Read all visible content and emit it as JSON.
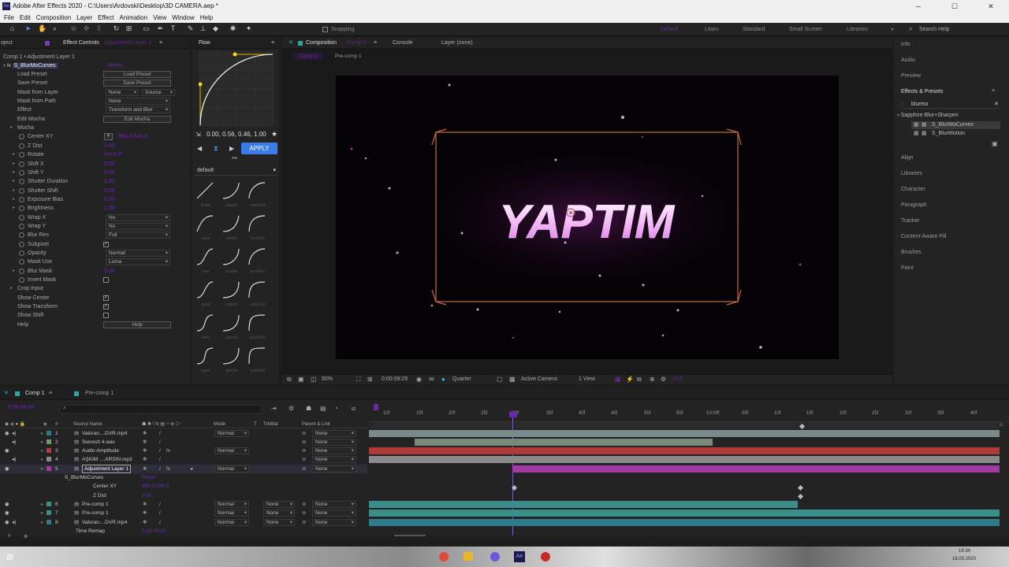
{
  "window": {
    "title": "Adobe After Effects 2020 - C:\\Users\\Ardovski\\Desktop\\3D CAMERA.aep *",
    "minimize": "─",
    "maximize": "☐",
    "close": "✕"
  },
  "menu": [
    "File",
    "Edit",
    "Composition",
    "Layer",
    "Effect",
    "Animation",
    "View",
    "Window",
    "Help"
  ],
  "toolbar": {
    "snapping": "Snapping",
    "workspaces": [
      "Default",
      "Learn",
      "Standard",
      "Small Screen",
      "Libraries"
    ],
    "more": "»",
    "search_placeholder": "Search Help"
  },
  "effect_controls": {
    "tab_left": "oject",
    "tab": "Effect Controls",
    "tab_suffix": "Adjustment Layer 1",
    "breadcrumb": "Comp 1 • Adjustment Layer 1",
    "effect_name": "S_BlurMoCurves",
    "effect_reset": "Reset",
    "rows": [
      {
        "label": "Load Preset",
        "button": "Load Preset"
      },
      {
        "label": "Save Preset",
        "button": "Save Preset"
      },
      {
        "label": "Mask from Layer",
        "dd1": "None",
        "dd2": "Source"
      },
      {
        "label": "Mask from Path",
        "dd1": "None"
      },
      {
        "label": "Effect",
        "dd1": "Transform and Blur"
      },
      {
        "label": "Edit Mocha",
        "button": "Edit Mocha"
      },
      {
        "label": "Mocha"
      },
      {
        "label": "Center XY",
        "value": "960.0,540.0"
      },
      {
        "label": "Z Dist",
        "value": "0.00"
      },
      {
        "label": "Rotate",
        "value": "0x+0.0°"
      },
      {
        "label": "Shift X",
        "value": "0.00"
      },
      {
        "label": "Shift Y",
        "value": "0.00"
      },
      {
        "label": "Shutter Duration",
        "value": "1.00"
      },
      {
        "label": "Shutter Shift",
        "value": "0.00"
      },
      {
        "label": "Exposure Bias",
        "value": "0.00"
      },
      {
        "label": "Brightness",
        "value": "1.00"
      },
      {
        "label": "Wrap X",
        "dd1": "No"
      },
      {
        "label": "Wrap Y",
        "dd1": "No"
      },
      {
        "label": "Blur Res",
        "dd1": "Full"
      },
      {
        "label": "Subpixel",
        "checked": true
      },
      {
        "label": "Opacity",
        "dd1": "Normal"
      },
      {
        "label": "Mask Use",
        "dd1": "Luma"
      },
      {
        "label": "Blur Mask",
        "value": "0.00"
      },
      {
        "label": "Invert Mask",
        "checked": false
      },
      {
        "label": "Crop Input"
      },
      {
        "label": "Show Center",
        "checked": true
      },
      {
        "label": "Show Transform",
        "checked": true
      },
      {
        "label": "Show Shift",
        "checked": false
      },
      {
        "label": "Help",
        "button": "Help"
      }
    ]
  },
  "flow": {
    "tab": "Flow",
    "values": "0.00, 0.56, 0.46, 1.00",
    "apply": "APPLY",
    "preset": "default",
    "curves": [
      "linear",
      "easeIn",
      "easeOut",
      "ease",
      "sineIn",
      "sineOut",
      "sine",
      "quadIn",
      "quadOut",
      "quad",
      "cubicIn",
      "cubicOut",
      "cubic",
      "quartIn",
      "quartOut",
      "quart",
      "quintIn",
      "quintOut"
    ]
  },
  "composition": {
    "tabs": [
      "Composition",
      "Console",
      "Layer (none)"
    ],
    "comp_suffix": "Comp 1",
    "sub_tabs": [
      "Comp 1",
      "Pre-comp 1"
    ],
    "overlay_text": "YAPTIM",
    "zoom": "50%",
    "timecode": "0:00:09:29",
    "resolution": "Quarter",
    "camera": "Active Camera",
    "views": "1 View",
    "exposure": "+0.0"
  },
  "right_panel": {
    "items": [
      "Info",
      "Audio",
      "Preview",
      "Effects & Presets",
      "Align",
      "Libraries",
      "Character",
      "Paragraph",
      "Tracker",
      "Content-Aware Fill",
      "Brushes",
      "Paint"
    ],
    "search": "blurmo",
    "group": "Sapphire Blur+Sharpen",
    "results": [
      "S_BlurMoCurves",
      "S_BlurMotion"
    ]
  },
  "timeline": {
    "tabs": [
      "Comp 1",
      "Pre-comp 1"
    ],
    "timecode": "0:00:09:29",
    "search_placeholder": "⌕",
    "headers": {
      "source_name": "Source Name",
      "mode": "Mode",
      "t": "T",
      "trkmat": "TrkMat",
      "parent": "Parent & Link"
    },
    "ruler": [
      "10f",
      "15f",
      "20f",
      "25f",
      "00f",
      "35f",
      "40f",
      "45f",
      "50f",
      "55f",
      "10:00f",
      "05f",
      "10f",
      "15f",
      "20f",
      "25f",
      "30f",
      "35f",
      "40f"
    ],
    "layers": [
      {
        "num": "1",
        "name": "Valoran....DVR.mp4",
        "mode": "Normal",
        "trkmat": "",
        "parent": "None",
        "color": "#2e7c8a"
      },
      {
        "num": "2",
        "name": "Swoosh 4.wav",
        "mode": "",
        "trkmat": "",
        "parent": "None",
        "color": "#6f9a6f"
      },
      {
        "num": "3",
        "name": "Audio Amplitude",
        "mode": "Normal",
        "trkmat": "",
        "parent": "None",
        "color": "#b23a3a"
      },
      {
        "num": "4",
        "name": "AŞKIM ....ARSIN.mp3",
        "mode": "",
        "trkmat": "",
        "parent": "None",
        "color": "#8a8a8a"
      },
      {
        "num": "5",
        "name": "Adjustment Layer 1",
        "mode": "Normal",
        "trkmat": "",
        "parent": "None",
        "color": "#a33aa6"
      },
      {
        "num": "6",
        "name": "Pre-comp 1",
        "mode": "Normal",
        "trkmat": "None",
        "parent": "None",
        "color": "#3a8f8a"
      },
      {
        "num": "7",
        "name": "Pre-comp 1",
        "mode": "Normal",
        "trkmat": "None",
        "parent": "None",
        "color": "#3a8f8a"
      },
      {
        "num": "8",
        "name": "Valoran....DVR.mp4",
        "mode": "Normal",
        "trkmat": "None",
        "parent": "None",
        "color": "#2e7c8a"
      }
    ],
    "sub_rows": {
      "effect": "S_BlurMoCurves",
      "effect_reset": "Reset",
      "center": "Center XY",
      "center_val": "960.0,540.0",
      "zdist": "Z Dist",
      "zdist_val": "0.00",
      "remap": "Time Remap",
      "remap_val": "0:00:09:29"
    }
  },
  "taskbar": {
    "clock": "19:34",
    "date": "18.03.2020"
  }
}
